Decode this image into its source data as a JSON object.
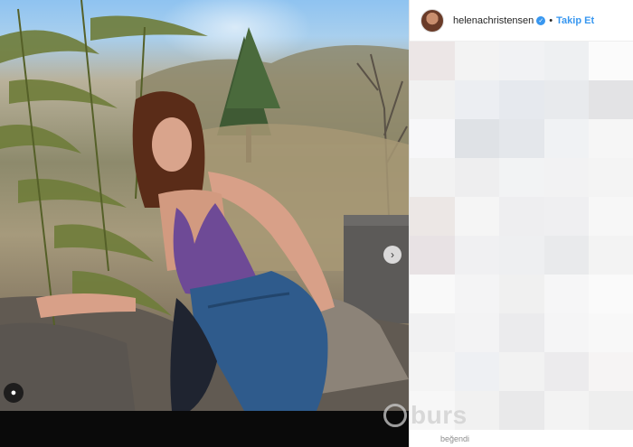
{
  "header": {
    "username": "helenachristensen",
    "verified_icon": "verified-badge-icon",
    "separator": "•",
    "follow_label": "Takip Et"
  },
  "photo": {
    "user_tag_icon": "person-icon",
    "next_icon": "chevron-right-icon"
  },
  "footer": {
    "text": "beğendi"
  },
  "watermark": {
    "text": "burs"
  },
  "mosaic_colors": [
    "#ece6e6",
    "#f3f3f3",
    "#f1f2f4",
    "#eef0f2",
    "#fbfbfb",
    "#f1f1f1",
    "#eceef2",
    "#e6e9ee",
    "#e8eaed",
    "#e3e3e5",
    "#f7f7f9",
    "#dfe2e6",
    "#e4e7eb",
    "#f0f2f4",
    "#f6f6f6",
    "#f2f2f2",
    "#eeeeef",
    "#f2f3f4",
    "#f2f2f3",
    "#f4f4f4",
    "#ece7e5",
    "#f5f5f5",
    "#eeeef0",
    "#efeff1",
    "#f7f7f7",
    "#e8e2e4",
    "#f0f0f2",
    "#eeeff1",
    "#e9eaec",
    "#f3f3f3",
    "#f9f9f9",
    "#f4f4f5",
    "#f0f0f0",
    "#f6f6f7",
    "#fafafa",
    "#f1f1f2",
    "#f3f3f4",
    "#ebebed",
    "#f5f5f6",
    "#f8f8f8",
    "#f4f4f4",
    "#eef0f3",
    "#f2f2f2",
    "#ecebed",
    "#f6f4f4",
    "#f7f7f7",
    "#f1f1f1",
    "#e9e9ea",
    "#f3f3f3",
    "#eeeeee"
  ]
}
